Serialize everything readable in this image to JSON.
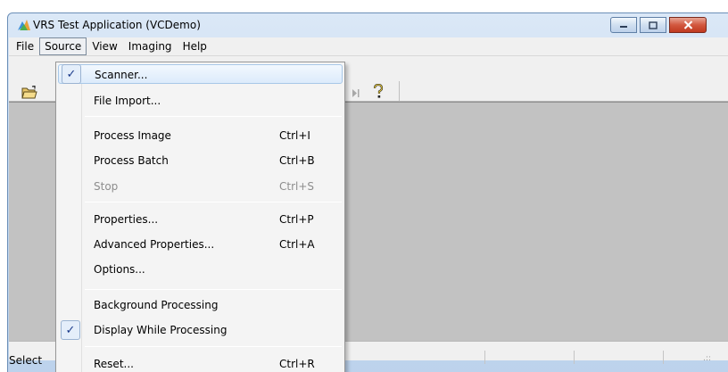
{
  "window": {
    "title": "VRS Test Application (VCDemo)"
  },
  "menubar": {
    "items": [
      "File",
      "Source",
      "View",
      "Imaging",
      "Help"
    ],
    "open_menu": "Source"
  },
  "source_menu": {
    "items": [
      {
        "label": "Scanner...",
        "shortcut": "",
        "checked": true,
        "highlighted": true
      },
      {
        "label": "File Import...",
        "shortcut": ""
      },
      {
        "label": "Process Image",
        "shortcut": "Ctrl+I"
      },
      {
        "label": "Process Batch",
        "shortcut": "Ctrl+B"
      },
      {
        "label": "Stop",
        "shortcut": "Ctrl+S",
        "disabled": true
      },
      {
        "label": "Properties...",
        "shortcut": "Ctrl+P"
      },
      {
        "label": "Advanced Properties...",
        "shortcut": "Ctrl+A"
      },
      {
        "label": "Options...",
        "shortcut": ""
      },
      {
        "label": "Background Processing",
        "shortcut": ""
      },
      {
        "label": "Display While Processing",
        "shortcut": "",
        "checked": true
      },
      {
        "label": "Reset...",
        "shortcut": "Ctrl+R"
      }
    ],
    "check_mark": "✓"
  },
  "toolbar": {
    "icons": [
      "open-folder-icon",
      "step-forward-icon",
      "help-icon"
    ]
  },
  "statusbar": {
    "text": "Select"
  },
  "colors": {
    "client_area": "#c2c2c2",
    "menu_background": "#f4f4f4",
    "close_button": "#c0391f"
  }
}
